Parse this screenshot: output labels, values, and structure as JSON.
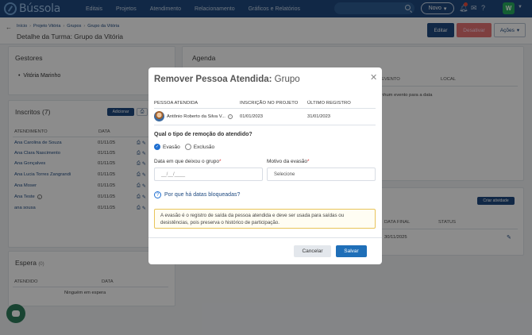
{
  "app": {
    "logo_text": "Bússola",
    "nav": [
      "Editais",
      "Projetos",
      "Atendimento",
      "Relacionamento",
      "Gráficos e Relatórios"
    ],
    "new_button": "Novo",
    "user_initial": "W"
  },
  "header": {
    "breadcrumb": [
      "Início",
      "Projeto Vitória",
      "Grupos",
      "Grupo da Vitória"
    ],
    "title": "Detalhe da Turma: Grupo da Vitória",
    "edit_label": "Editar",
    "deactivate_label": "Desativar",
    "actions_label": "Ações"
  },
  "gestores": {
    "title": "Gestores",
    "items": [
      "Vitória Marinho"
    ]
  },
  "inscritos": {
    "title": "Inscritos (7)",
    "add_label": "Adicionar",
    "columns": [
      "ATENDIMENTO",
      "DATA"
    ],
    "rows": [
      {
        "name": "Ana Carolina de Souza",
        "date": "01/11/25"
      },
      {
        "name": "Ana Clara Nascimento",
        "date": "01/11/25"
      },
      {
        "name": "Ana Gonçalves",
        "date": "01/11/25"
      },
      {
        "name": "Ana Lucia Torres Zangrandi",
        "date": "01/11/25"
      },
      {
        "name": "Ana Moser",
        "date": "01/11/25"
      },
      {
        "name": "Ana Teste",
        "date": "01/11/25"
      },
      {
        "name": "ana sousa",
        "date": "01/11/25"
      }
    ]
  },
  "espera": {
    "title": "Espera",
    "count": "(0)",
    "columns": [
      "ATENDIDO",
      "DATA"
    ],
    "empty": "Ninguém em espera"
  },
  "agenda": {
    "title": "Agenda",
    "columns": [
      "EVENTO",
      "LOCAL"
    ],
    "empty": "nhum evento para a data"
  },
  "atividades": {
    "create_label": "Criar atividade",
    "columns": [
      "DATA FINAL",
      "STATUS"
    ],
    "row_date": "30/11/2025"
  },
  "modal": {
    "title_prefix": "Remover Pessoa Atendida:",
    "title_suffix": " Grupo",
    "columns": [
      "PESSOA ATENDIDA",
      "INSCRIÇÃO NO PROJETO",
      "ÚLTIMO REGISTRO"
    ],
    "person_name": "Antônio Roberto da Silva V...",
    "inscricao": "01/01/2023",
    "ultimo": "31/01/2023",
    "question": "Qual o tipo de remoção do atendido?",
    "option_evasao": "Evasão",
    "option_exclusao": "Exclusão",
    "date_label": "Data em que deixou o grupo",
    "date_placeholder": "__/__/____",
    "reason_label": "Motivo da evasão",
    "reason_value": "Selecione",
    "help_link": "Por que há datas bloqueadas?",
    "note": "A evasão é o registro de saída da pessoa atendida e deve ser usada para saídas ou desistências, pois preserva o histórico de participação.",
    "cancel_label": "Cancelar",
    "save_label": "Salvar"
  }
}
